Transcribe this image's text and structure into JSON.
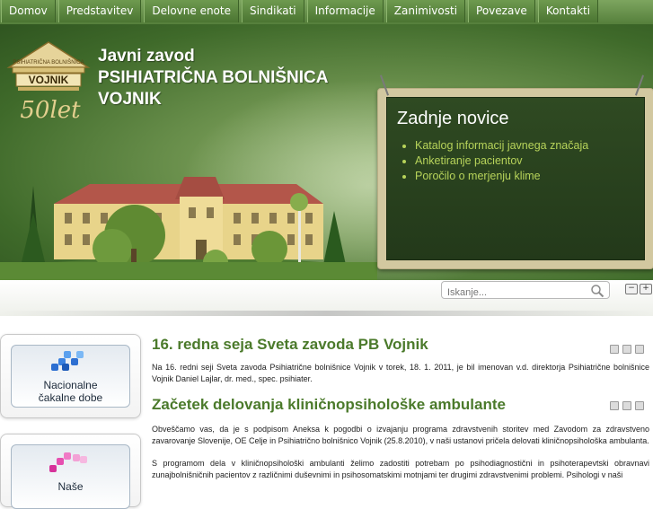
{
  "nav": {
    "items": [
      "Domov",
      "Predstavitev",
      "Delovne enote",
      "Sindikati",
      "Informacije",
      "Zanimivosti",
      "Povezave",
      "Kontakti"
    ]
  },
  "header": {
    "logo_ring_text": "PSIHIATRIČNA BOLNIŠNICA",
    "logo_name": "VOJNIK",
    "logo_anniversary": "50let",
    "title_line1": "Javni zavod",
    "title_line2": "PSIHIATRIČNA BOLNIŠNICA",
    "title_line3": "VOJNIK"
  },
  "news_board": {
    "heading": "Zadnje novice",
    "items": [
      "Katalog informacij javnega značaja",
      "Anketiranje pacientov",
      "Poročilo o merjenju klime"
    ]
  },
  "search": {
    "placeholder": "Iskanje..."
  },
  "font_controls": {
    "decrease": "−",
    "increase": "+"
  },
  "sidebar": {
    "boxes": [
      {
        "label_line1": "Nacionalne",
        "label_line2": "čakalne dobe"
      },
      {
        "label_line1": "Naše",
        "label_line2": ""
      }
    ]
  },
  "articles": [
    {
      "title": "16. redna seja Sveta zavoda PB Vojnik",
      "paragraphs": [
        "Na 16. redni seji Sveta zavoda Psihiatrične bolnišnice Vojnik v torek, 18. 1. 2011, je bil imenovan v.d. direktorja Psihiatrične bolnišnice Vojnik Daniel Lajlar, dr. med., spec. psihiater."
      ]
    },
    {
      "title": "Začetek delovanja kliničnopsihološke ambulante",
      "paragraphs": [
        "Obveščamo vas, da je s podpisom Aneksa k pogodbi o izvajanju programa zdravstvenih storitev med Zavodom za zdravstveno zavarovanje Slovenije, OE Celje in Psihiatrično bolnišnico Vojnik (25.8.2010), v naši ustanovi pričela delovati kliničnopsihološka ambulanta.",
        "S programom dela v kliničnopsihološki ambulanti želimo zadostiti potrebam po psihodiagnostični in psihoterapevtski obravnavi zunajbolnišničnih pacientov z različnimi duševnimi in psihosomatskimi motnjami ter drugimi zdravstvenimi problemi. Psihologi v naši"
      ]
    }
  ],
  "colors": {
    "nav_green": "#5f8a42",
    "title_green": "#4b7a2b",
    "board_link": "#b7d35a",
    "board_bg": "#2f4a22"
  }
}
